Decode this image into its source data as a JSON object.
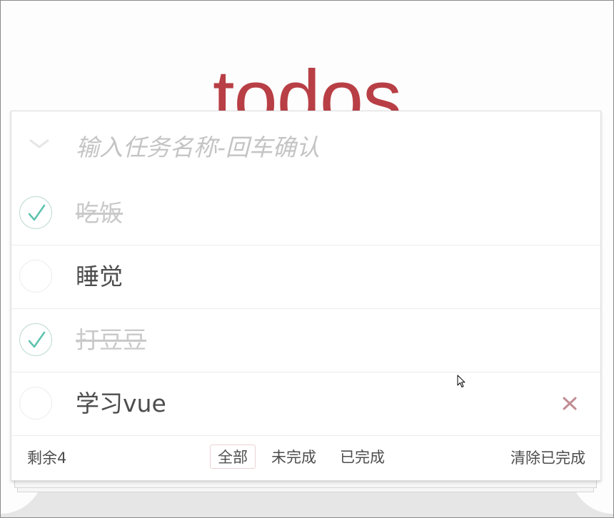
{
  "app": {
    "title": "todos"
  },
  "header": {
    "new_todo_placeholder": "输入任务名称-回车确认",
    "new_todo_value": ""
  },
  "todos": [
    {
      "title": "吃饭",
      "completed": true
    },
    {
      "title": "睡觉",
      "completed": false
    },
    {
      "title": "打豆豆",
      "completed": true
    },
    {
      "title": "学习vue",
      "completed": false
    }
  ],
  "footer": {
    "count_label": "剩余4",
    "filters": [
      {
        "label": "全部",
        "selected": true
      },
      {
        "label": "未完成",
        "selected": false
      },
      {
        "label": "已完成",
        "selected": false
      }
    ],
    "clear_label": "清除已完成"
  },
  "colors": {
    "title": "#b83f45",
    "check": "#5dc2af",
    "destroy": "#c18d93",
    "selected_filter_border": "#ebd3d5"
  },
  "icons": {
    "toggle_all": "chevron-down-icon",
    "check": "check-icon",
    "destroy": "close-icon",
    "cursor": "mouse-pointer-icon"
  }
}
